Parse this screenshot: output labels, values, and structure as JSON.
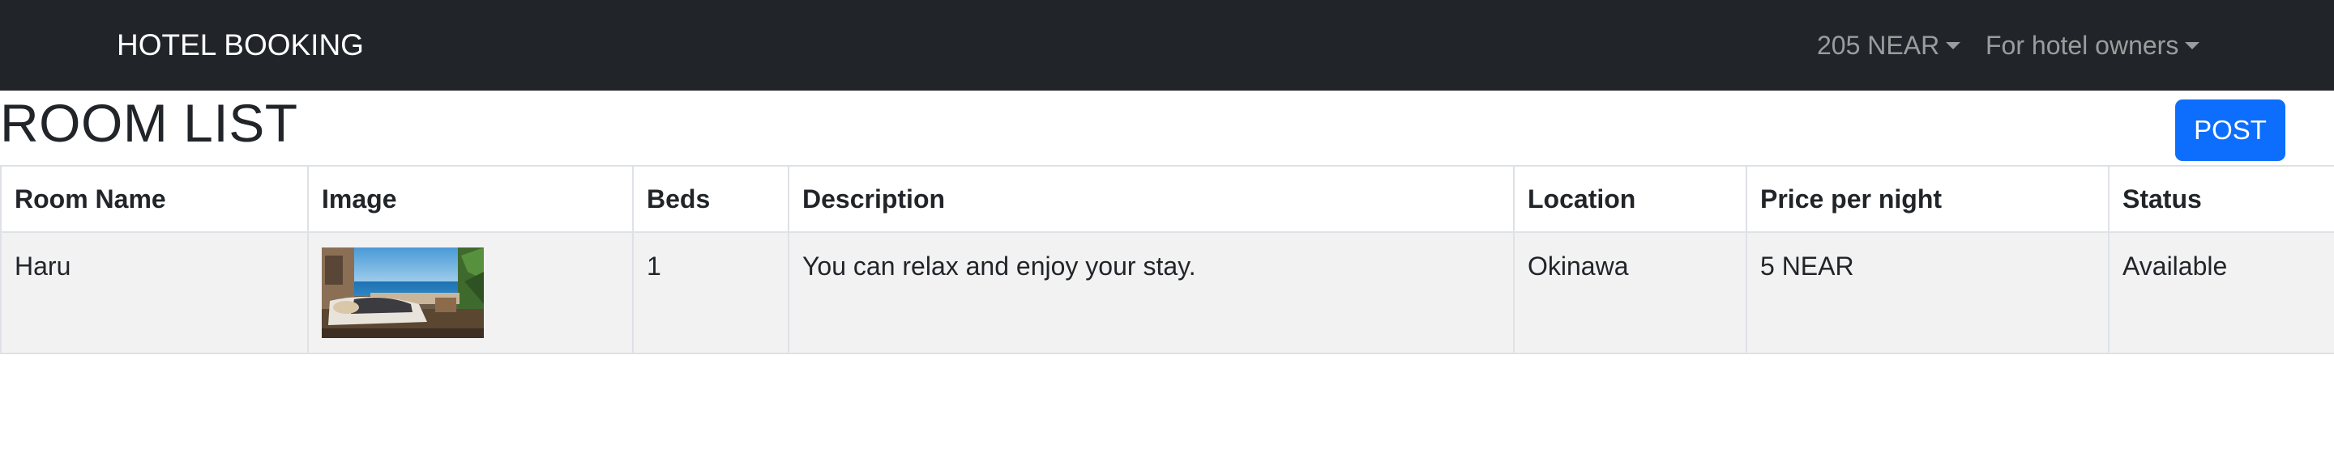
{
  "navbar": {
    "brand": "HOTEL BOOKING",
    "account_balance": "205 NEAR",
    "owners_menu": "For hotel owners"
  },
  "page": {
    "title": "ROOM LIST",
    "post_button": "POST"
  },
  "table": {
    "headers": [
      "Room Name",
      "Image",
      "Beds",
      "Description",
      "Location",
      "Price per night",
      "Status"
    ],
    "rows": [
      {
        "name": "Haru",
        "beds": "1",
        "description": "You can relax and enjoy your stay.",
        "location": "Okinawa",
        "price": "5 NEAR",
        "status": "Available"
      }
    ]
  },
  "colors": {
    "navbar_bg": "#212529",
    "primary": "#0d6efd",
    "row_bg": "#f2f2f2"
  }
}
